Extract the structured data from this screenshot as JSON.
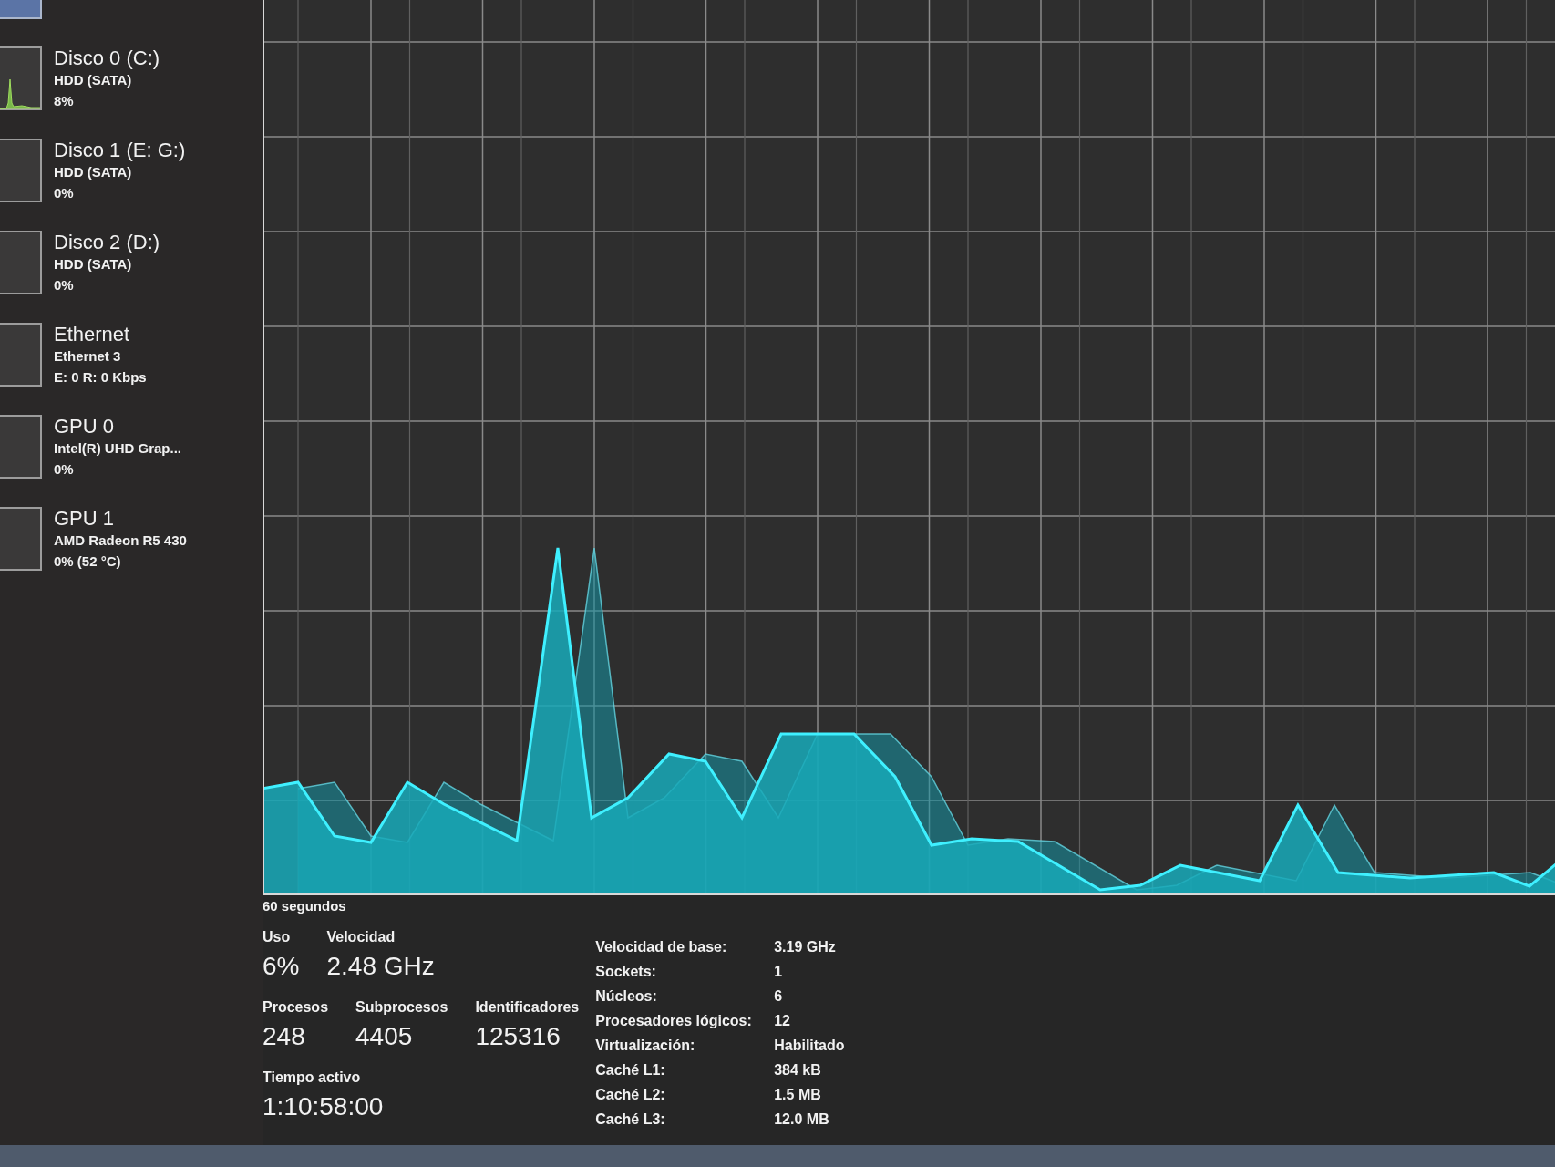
{
  "sidebar": {
    "items": [
      {
        "title": "Disco 0 (C:)",
        "subtitle": "HDD (SATA)",
        "reading": "8%",
        "selected": false,
        "activity": true
      },
      {
        "title": "Disco 1 (E: G:)",
        "subtitle": "HDD (SATA)",
        "reading": "0%",
        "selected": false,
        "activity": false
      },
      {
        "title": "Disco 2 (D:)",
        "subtitle": "HDD (SATA)",
        "reading": "0%",
        "selected": false,
        "activity": false
      },
      {
        "title": "Ethernet",
        "subtitle": "Ethernet 3",
        "reading": "E: 0 R: 0 Kbps",
        "selected": false,
        "activity": false
      },
      {
        "title": "GPU 0",
        "subtitle": "Intel(R) UHD Grap...",
        "reading": "0%",
        "selected": false,
        "activity": false
      },
      {
        "title": "GPU 1",
        "subtitle": "AMD Radeon R5 430",
        "reading": "0% (52 °C)",
        "selected": false,
        "activity": false
      }
    ]
  },
  "graph": {
    "time_label": "60 segundos"
  },
  "stats": {
    "rows": [
      [
        {
          "label": "Uso",
          "value": "6%"
        },
        {
          "label": "Velocidad",
          "value": "2.48 GHz"
        }
      ],
      [
        {
          "label": "Procesos",
          "value": "248"
        },
        {
          "label": "Subprocesos",
          "value": "4405"
        },
        {
          "label": "Identificadores",
          "value": "125316"
        }
      ],
      [
        {
          "label": "Tiempo activo",
          "value": "1:10:58:00"
        }
      ]
    ]
  },
  "details": [
    {
      "label": "Velocidad de base:",
      "value": "3.19 GHz"
    },
    {
      "label": "Sockets:",
      "value": "1"
    },
    {
      "label": "Núcleos:",
      "value": "6"
    },
    {
      "label": "Procesadores lógicos:",
      "value": "12"
    },
    {
      "label": "Virtualización:",
      "value": "Habilitado"
    },
    {
      "label": "Caché L1:",
      "value": "384 kB"
    },
    {
      "label": "Caché L2:",
      "value": "1.5 MB"
    },
    {
      "label": "Caché L3:",
      "value": "12.0 MB"
    }
  ]
}
